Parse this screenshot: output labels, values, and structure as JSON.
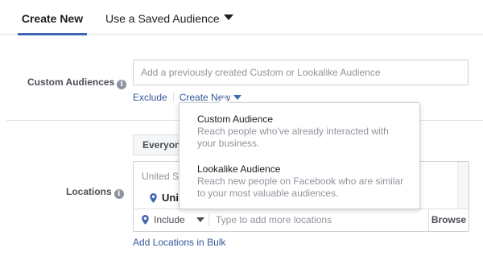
{
  "tabs": {
    "create_new": "Create New",
    "saved_audience": "Use a Saved Audience"
  },
  "custom_audiences": {
    "label": "Custom Audiences",
    "placeholder": "Add a previously created Custom or Lookalike Audience",
    "exclude_link": "Exclude",
    "create_new_link": "Create New"
  },
  "create_menu": {
    "items": [
      {
        "title": "Custom Audience",
        "description": "Reach people who've already interacted with your business."
      },
      {
        "title": "Lookalike Audience",
        "description": "Reach new people on Facebook who are similar to your most valuable audiences."
      }
    ]
  },
  "locations": {
    "label": "Locations",
    "audience_button": "Everyone in this location",
    "country_text": "United States",
    "selected_location": "United States",
    "include_label": "Include",
    "input_placeholder": "Type to add more locations",
    "browse_label": "Browse",
    "add_bulk_link": "Add Locations in Bulk"
  },
  "colors": {
    "accent": "#4267b2",
    "link": "#365899",
    "border": "#ccd0d5",
    "muted_text": "#90949c"
  },
  "icons": [
    "info-icon",
    "chevron-down-icon",
    "location-pin-icon"
  ]
}
